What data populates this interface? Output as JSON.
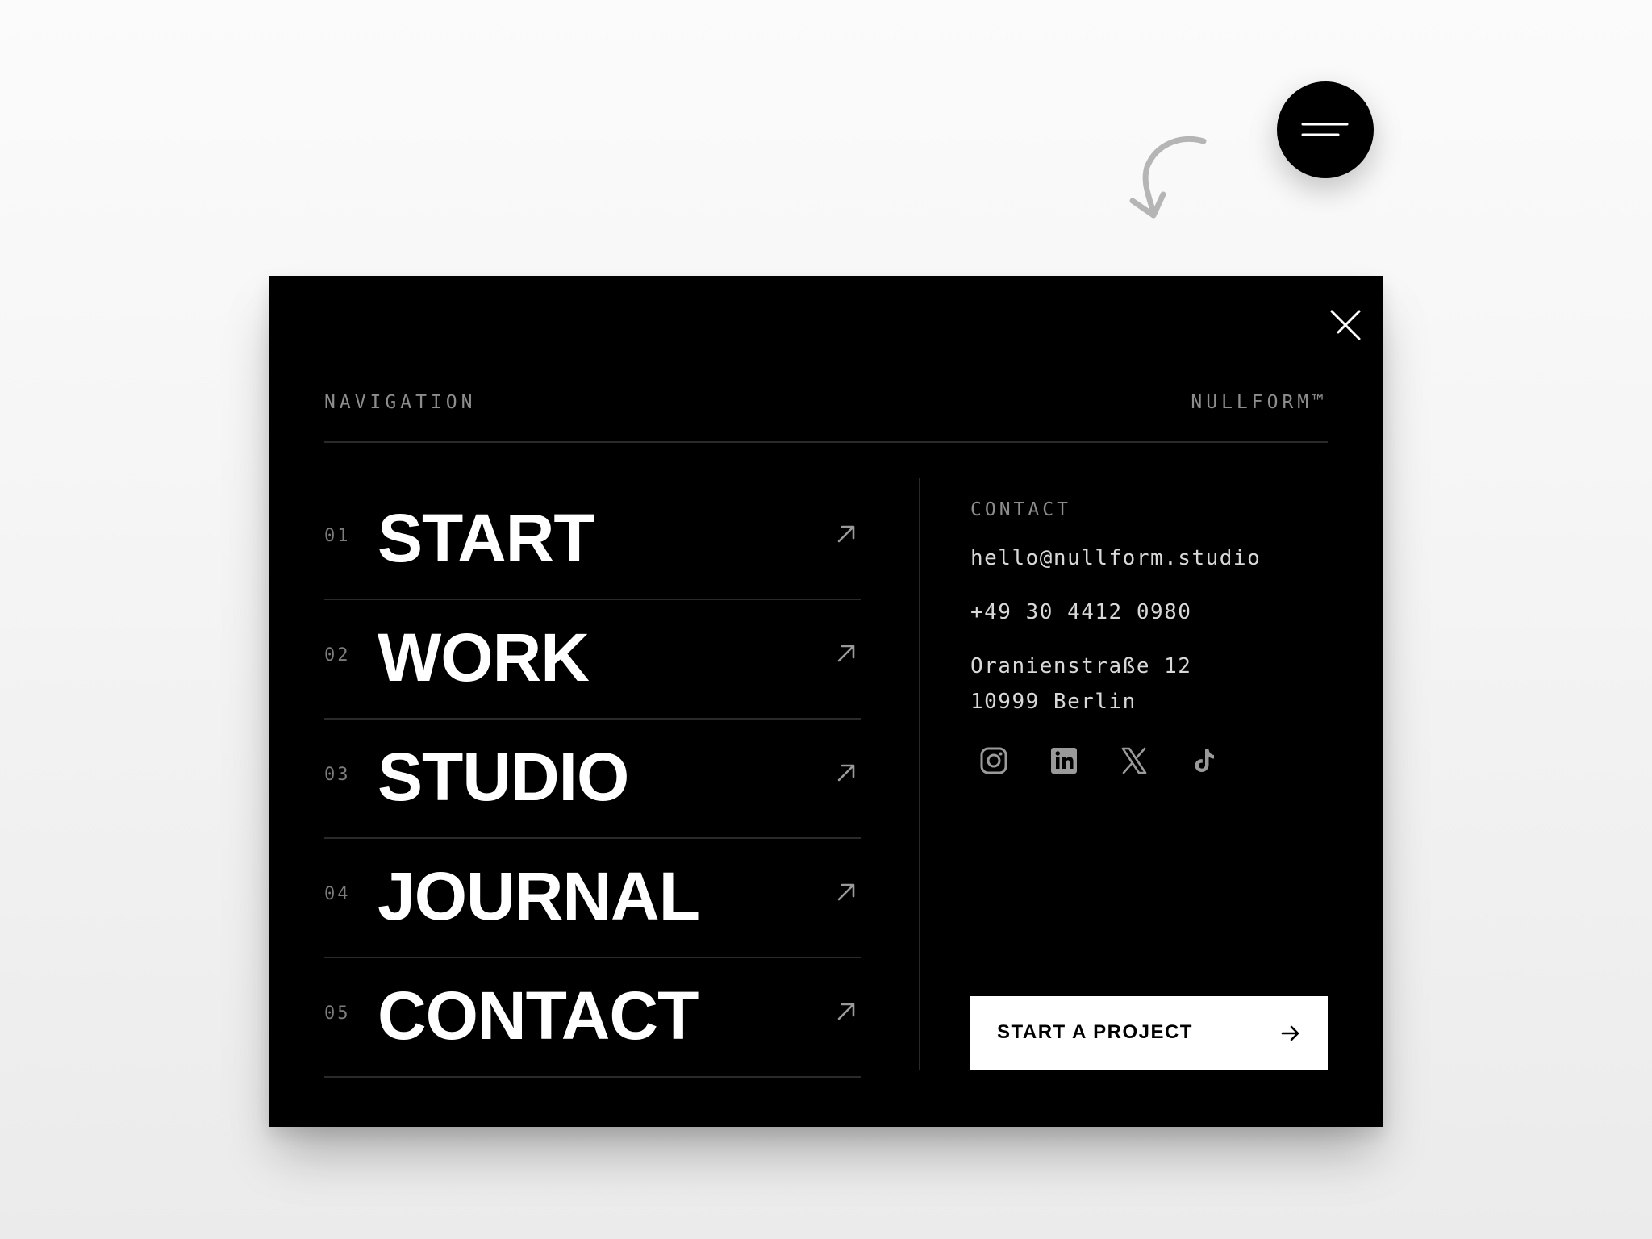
{
  "menu_button": {
    "icon": "hamburger-icon"
  },
  "hint_arrow": {
    "icon": "curved-arrow-icon",
    "color": "#b5b5b5"
  },
  "panel": {
    "background": "#000000",
    "close_icon": "close-icon",
    "nav_label": "NAVIGATION",
    "brand": "NULLFORM™",
    "nav_items": [
      {
        "number": "01",
        "label": "START",
        "icon": "arrow-up-right-icon"
      },
      {
        "number": "02",
        "label": "WORK",
        "icon": "arrow-up-right-icon"
      },
      {
        "number": "03",
        "label": "STUDIO",
        "icon": "arrow-up-right-icon"
      },
      {
        "number": "04",
        "label": "JOURNAL",
        "icon": "arrow-up-right-icon"
      },
      {
        "number": "05",
        "label": "CONTACT",
        "icon": "arrow-up-right-icon"
      }
    ],
    "contact": {
      "label": "CONTACT",
      "email": "hello@nullform.studio",
      "phone": "+49 30 4412 0980",
      "address_line1": "Oranienstraße 12",
      "address_line2": "10999 Berlin",
      "socials": [
        {
          "icon": "instagram-icon"
        },
        {
          "icon": "linkedin-icon"
        },
        {
          "icon": "x-icon"
        },
        {
          "icon": "tiktok-icon"
        }
      ]
    },
    "cta": {
      "label": "START A PROJECT",
      "icon": "arrow-right-icon"
    }
  }
}
